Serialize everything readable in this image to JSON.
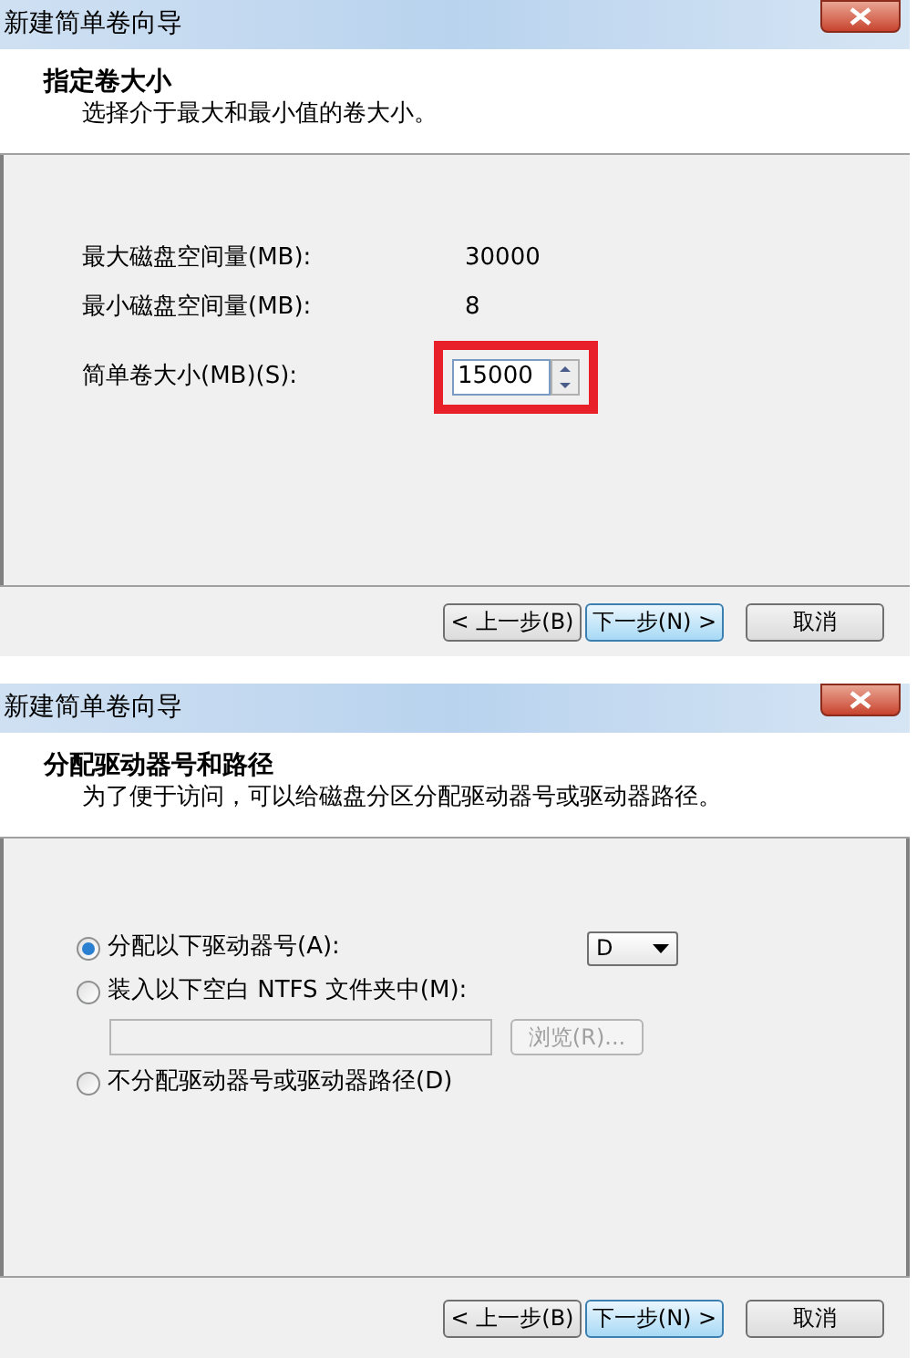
{
  "dialogs": [
    {
      "kind": "size",
      "title": "新建简单卷向导",
      "heading": "指定卷大小",
      "subheading": "选择介于最大和最小值的卷大小。",
      "fields": [
        {
          "label": "最大磁盘空间量(MB):",
          "value": "30000"
        },
        {
          "label": "最小磁盘空间量(MB):",
          "value": "8"
        }
      ],
      "spin": {
        "label": "简单卷大小(MB)(S):",
        "value": "15000",
        "highlighted": true
      },
      "buttons": [
        {
          "label": "< 上一步(B)",
          "focused": false
        },
        {
          "label": "下一步(N) >",
          "focused": true
        },
        {
          "label": "取消",
          "focused": false
        }
      ]
    },
    {
      "kind": "drive",
      "title": "新建简单卷向导",
      "heading": "分配驱动器号和路径",
      "subheading": "为了便于访问，可以给磁盘分区分配驱动器号或驱动器路径。",
      "options": [
        {
          "label": "分配以下驱动器号(A):",
          "selected": true,
          "dropdown": "D"
        },
        {
          "label": "装入以下空白 NTFS 文件夹中(M):",
          "selected": false,
          "browse": {
            "label": "浏览(R)...",
            "disabled": true
          }
        },
        {
          "label": "不分配驱动器号或驱动器路径(D)",
          "selected": false
        }
      ],
      "buttons": [
        {
          "label": "< 上一步(B)",
          "focused": false
        },
        {
          "label": "下一步(N) >",
          "focused": true
        },
        {
          "label": "取消",
          "focused": false
        }
      ]
    }
  ]
}
